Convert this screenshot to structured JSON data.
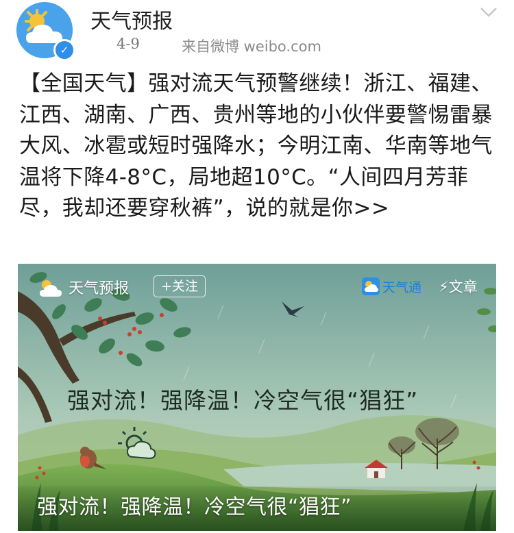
{
  "post": {
    "author": "天气预报",
    "date": "4-9",
    "source": "来自微博 weibo.com",
    "text": "【全国天气】强对流天气预警继续！浙江、福建、江西、湖南、广西、贵州等地的小伙伴要警惕雷暴大风、冰雹或短时强降水；今明江南、华南等地气温将下降4-8°C，局地超10°C。“人间四月芳菲尽，我却还要穿秋裤”，说的就是你>>"
  },
  "card": {
    "author": "天气预报",
    "follow_label": "+关注",
    "app_name": "天气通",
    "article_label": "⚡文章",
    "headline": "强对流！强降温！冷空气很“猖狂”",
    "caption": "强对流！强降温！冷空气很“猖狂”"
  },
  "icons": {
    "avatar": "sun-cloud-icon",
    "verified": "verified-badge-icon",
    "more": "chevron-down-icon",
    "app": "weather-app-icon"
  },
  "colors": {
    "accent": "#2f8ee8",
    "meta_text": "#888888"
  }
}
